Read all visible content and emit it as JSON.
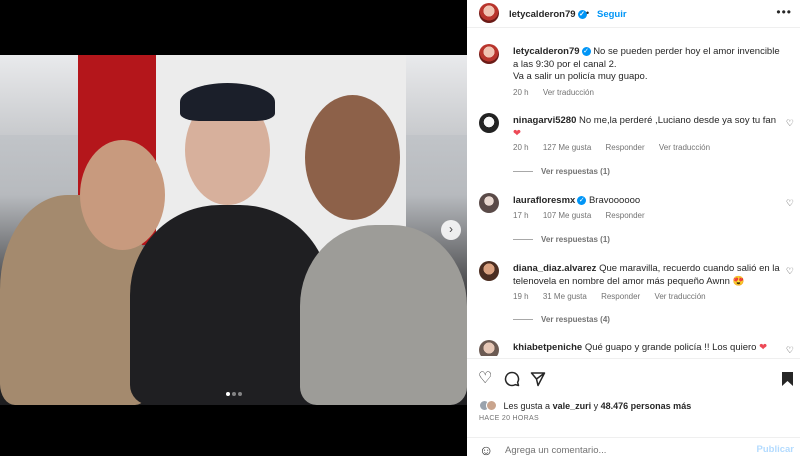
{
  "post": {
    "author": "letycalderon79",
    "follow_label": "Seguir",
    "more_label": "•••",
    "caption_line1": "No se pueden perder hoy el amor invencible a las 9:30 por el canal 2.",
    "caption_line2": "Va a salir un policía muy guapo.",
    "caption_time": "20 h",
    "caption_translate": "Ver traducción"
  },
  "carousel": {
    "slide_count": 3,
    "active_index": 0,
    "next_icon": "chevron-right"
  },
  "comments": [
    {
      "user": "ninagarvi5280",
      "text": "No me,la perderé ,Luciano desde ya soy tu fan",
      "emoji": "❤",
      "time": "20 h",
      "likes": "127 Me gusta",
      "reply": "Responder",
      "translate": "Ver traducción",
      "replies": "Ver respuestas (1)"
    },
    {
      "user": "laurafloresmx",
      "text": "Bravoooooo",
      "time": "17 h",
      "likes": "107 Me gusta",
      "reply": "Responder",
      "replies": "Ver respuestas (1)"
    },
    {
      "user": "diana_diaz.alvarez",
      "text": "Que maravilla, recuerdo cuando salió en la telenovela en nombre del amor más pequeño Awnn",
      "emoji": "😍",
      "time": "19 h",
      "likes": "31 Me gusta",
      "reply": "Responder",
      "translate": "Ver traducción",
      "replies": "Ver respuestas (4)"
    },
    {
      "user": "khiabetpeniche",
      "text": "Qué guapo y grande policía !! Los quiero",
      "emoji": "❤"
    }
  ],
  "likes": {
    "prefix": "Les gusta a",
    "user": "vale_zuri",
    "middle": "y",
    "count": "48.476 personas más"
  },
  "posted_ago": "HACE 20 HORAS",
  "composer": {
    "placeholder": "Agrega un comentario...",
    "post_label": "Publicar"
  },
  "icons": {
    "like": "heart-icon",
    "comment": "comment-icon",
    "share": "share-icon",
    "save": "bookmark-icon",
    "emoji": "emoji-icon",
    "verified": "verified-badge-icon"
  },
  "colors": {
    "accent": "#0095f6",
    "text": "#262626",
    "muted": "#737373",
    "heart": "#ed4956"
  }
}
